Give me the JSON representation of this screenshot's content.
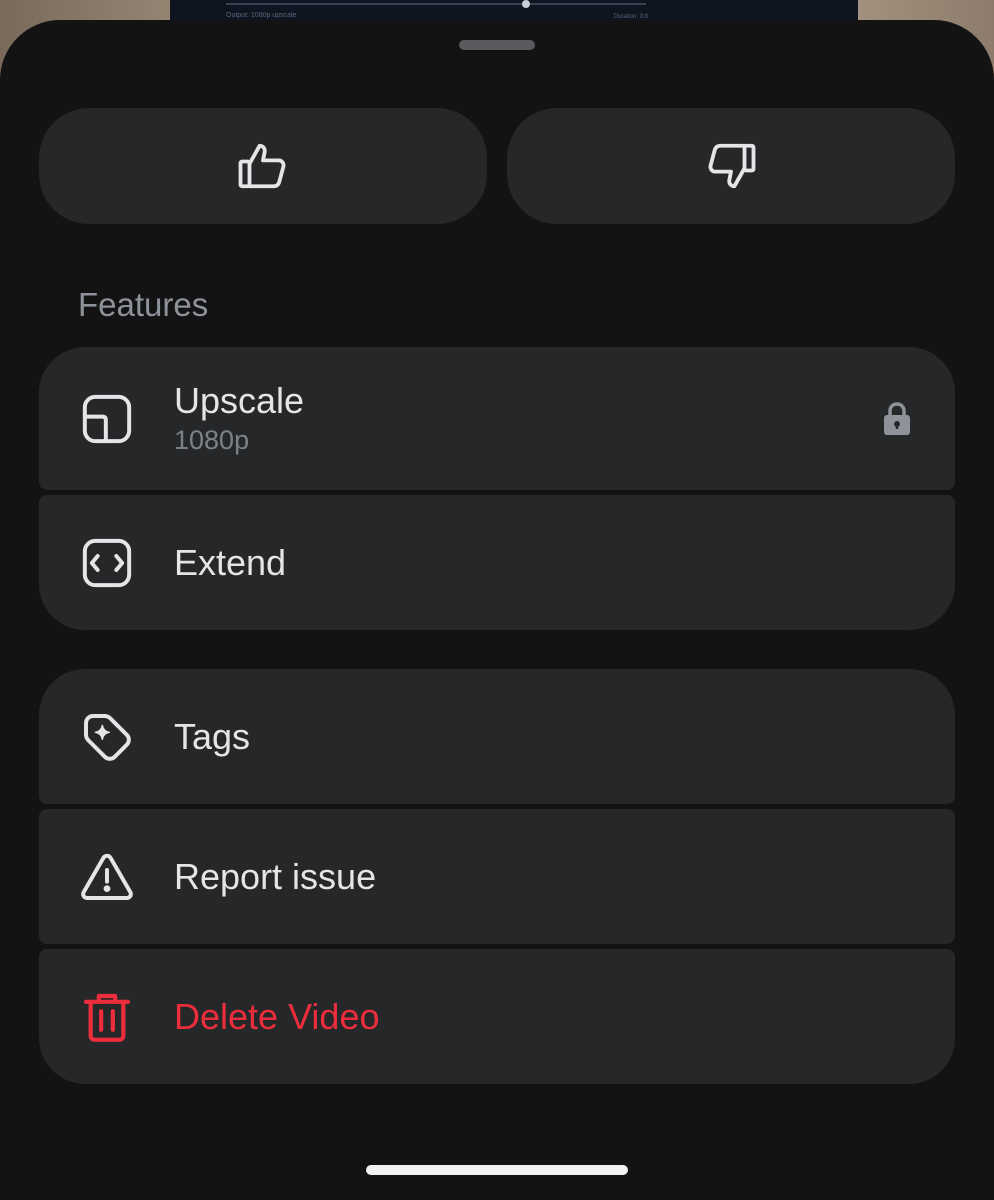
{
  "backdrop": {
    "meta_left": "Output: 1080p upscale",
    "meta_right": "Duration: 0:8"
  },
  "feedback": {
    "like_icon": "thumbs-up-icon",
    "dislike_icon": "thumbs-down-icon"
  },
  "features_section": {
    "label": "Features",
    "items": [
      {
        "icon": "upscale-icon",
        "label": "Upscale",
        "sublabel": "1080p",
        "locked": true,
        "lock_icon": "lock-icon"
      },
      {
        "icon": "extend-icon",
        "label": "Extend"
      }
    ]
  },
  "actions_section": {
    "items": [
      {
        "icon": "tag-sparkle-icon",
        "label": "Tags"
      },
      {
        "icon": "warning-icon",
        "label": "Report issue"
      },
      {
        "icon": "trash-icon",
        "label": "Delete Video",
        "color": "#ec2d3b"
      }
    ]
  },
  "colors": {
    "sheet_background": "#131314",
    "item_background": "#262729",
    "text_primary": "#e4e5e7",
    "text_secondary": "#7d8187",
    "danger": "#ec2d3b"
  }
}
